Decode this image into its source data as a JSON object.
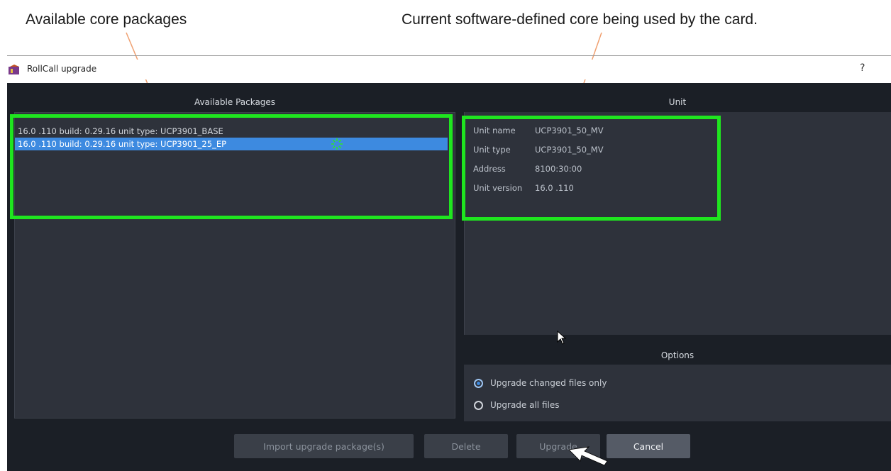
{
  "callouts": {
    "left": "Available core packages",
    "right": "Current software-defined core being used by the card."
  },
  "window": {
    "title": "RollCall upgrade",
    "help": "?"
  },
  "packages": {
    "header": "Available Packages",
    "items": [
      {
        "label": "16.0 .110 build: 0.29.16 unit type: UCP3901_BASE",
        "selected": false
      },
      {
        "label": "16.0 .110 build: 0.29.16 unit type: UCP3901_25_EP",
        "selected": true
      }
    ]
  },
  "unit": {
    "header": "Unit",
    "fields": [
      {
        "label": "Unit name",
        "value": "UCP3901_50_MV"
      },
      {
        "label": "Unit type",
        "value": "UCP3901_50_MV"
      },
      {
        "label": "Address",
        "value": "8100:30:00"
      },
      {
        "label": "Unit version",
        "value": "16.0 .110"
      }
    ]
  },
  "options": {
    "header": "Options",
    "choices": [
      {
        "label": "Upgrade changed files only",
        "checked": true
      },
      {
        "label": "Upgrade all files",
        "checked": false
      }
    ]
  },
  "buttons": {
    "import": "Import upgrade package(s)",
    "delete": "Delete",
    "upgrade": "Upgrade",
    "cancel": "Cancel"
  },
  "colors": {
    "highlight": "#1fe51f",
    "selection": "#3d8ae0",
    "dialog_bg": "#1b1f26"
  }
}
